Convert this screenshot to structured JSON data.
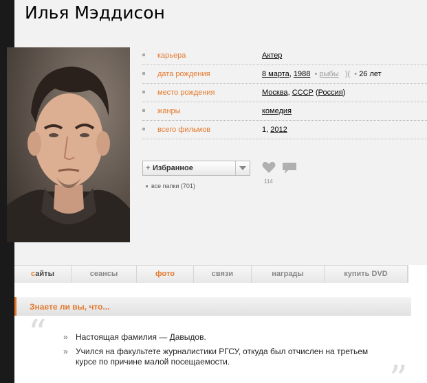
{
  "person": {
    "name": "Илья Мэддисон"
  },
  "info": [
    {
      "label": "карьера",
      "value": "Актер"
    },
    {
      "label": "дата рождения",
      "date": "8 марта",
      "year": "1988",
      "zodiac": "рыбы",
      "age": "26 лет"
    },
    {
      "label": "место рождения",
      "city": "Москва",
      "country": "СССР",
      "region": "Россия"
    },
    {
      "label": "жанры",
      "value": "комедия"
    },
    {
      "label": "всего фильмов",
      "count": "1",
      "year": "2012"
    }
  ],
  "favorites": {
    "button_label": "Избранное",
    "folders_link": "все папки (701)",
    "likes_count": "114"
  },
  "tabs": [
    {
      "first": "с",
      "rest": "айты"
    },
    {
      "label": "сеансы"
    },
    {
      "label": "фото"
    },
    {
      "label": "связи"
    },
    {
      "label": "награды"
    },
    {
      "label": "купить DVD"
    }
  ],
  "trivia": {
    "title": "Знаете ли вы, что...",
    "facts": [
      "Настоящая фамилия — Давыдов.",
      "Учился на факультете журналистики РГСУ, откуда был отчислен на третьем курсе по причине малой посещаемости."
    ]
  },
  "colors": {
    "accent": "#e4792d",
    "background": "#f2f2f2"
  }
}
